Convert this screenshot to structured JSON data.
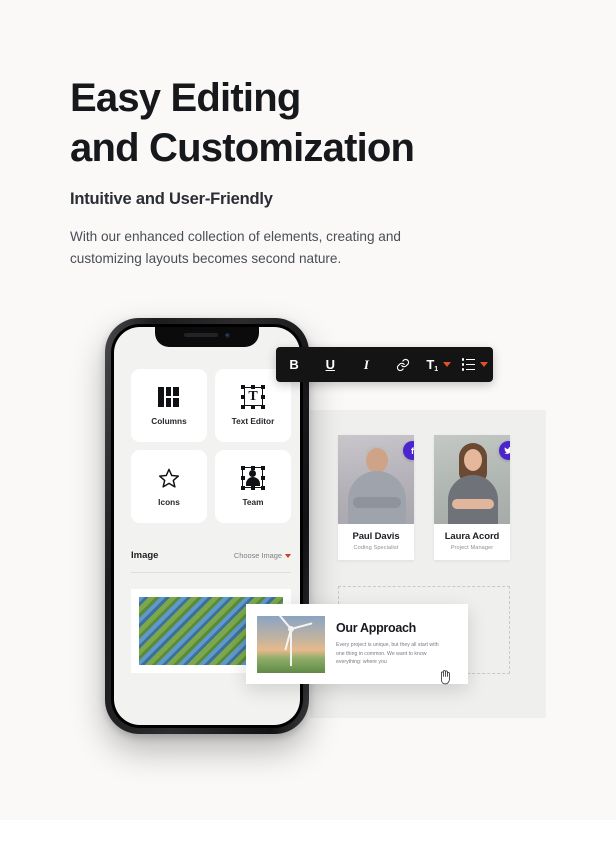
{
  "hero": {
    "headline_line1": "Easy Editing",
    "headline_line2": "and Customization",
    "subheadline": "Intuitive and User-Friendly",
    "body": "With our enhanced collection of elements, creating and customizing layouts becomes second nature."
  },
  "toolbar": {
    "bold_label": "B",
    "underline_label": "U",
    "italic_label": "I",
    "link_icon": "link-icon",
    "text_style_label": "T",
    "text_style_sub": "1",
    "list_icon": "bullet-list-icon"
  },
  "phone": {
    "widgets": [
      {
        "label": "Columns",
        "icon": "columns-icon"
      },
      {
        "label": "Text Editor",
        "icon": "text-editor-icon"
      },
      {
        "label": "Icons",
        "icon": "star-icon"
      },
      {
        "label": "Team",
        "icon": "person-icon"
      }
    ],
    "image_section": {
      "title": "Image",
      "choose_label": "Choose Image"
    }
  },
  "team": {
    "members": [
      {
        "name": "Paul Davis",
        "role": "Coding Specialist",
        "social": "facebook-icon",
        "social_glyph": "f"
      },
      {
        "name": "Laura Acord",
        "role": "Project Manager",
        "social": "twitter-icon",
        "social_glyph": "t"
      }
    ]
  },
  "approach_card": {
    "title": "Our Approach",
    "body": "Every project is unique, but they all start with one thing in common. We want to know everything: where you"
  },
  "colors": {
    "page_background": "#faf9f8",
    "panel_background": "#efefed",
    "toolbar_background": "#141414",
    "accent_caret": "#e2502a",
    "social_badge": "#4a25cd",
    "heading_text": "#16181c"
  }
}
